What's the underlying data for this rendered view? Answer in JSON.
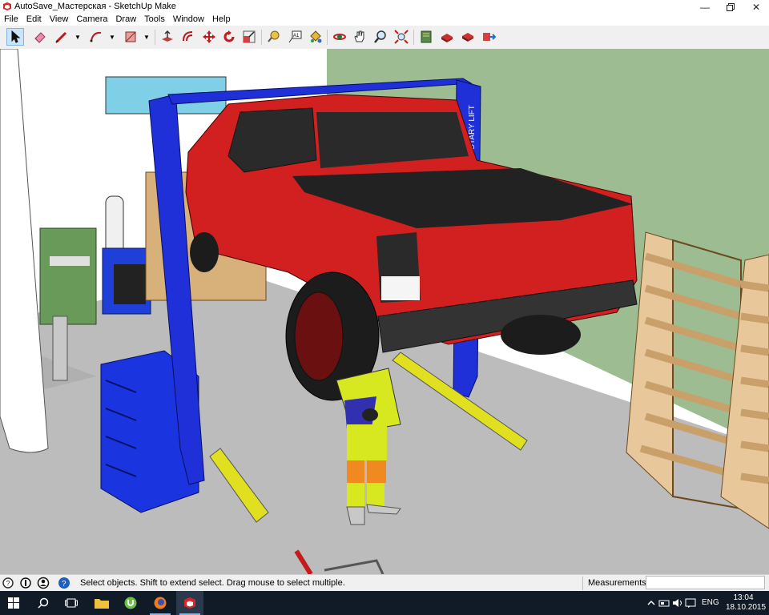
{
  "window": {
    "title": "AutoSave_Мастерская - SketchUp Make",
    "controls": [
      "minimize-icon",
      "restore-icon",
      "close-icon"
    ]
  },
  "menu": [
    "File",
    "Edit",
    "View",
    "Camera",
    "Draw",
    "Tools",
    "Window",
    "Help"
  ],
  "toolbar": {
    "tools": [
      {
        "name": "select-tool-icon",
        "active": true
      },
      {
        "name": "eraser-tool-icon"
      },
      {
        "name": "pencil-line-tool-icon",
        "dropdown": true
      },
      {
        "name": "arc-tool-icon",
        "dropdown": true
      },
      {
        "name": "shapes-tool-icon",
        "dropdown": true
      },
      {
        "name": "push-pull-tool-icon"
      },
      {
        "name": "offset-tool-icon"
      },
      {
        "name": "move-tool-icon"
      },
      {
        "name": "rotate-tool-icon"
      },
      {
        "name": "scale-tool-icon"
      },
      {
        "name": "tape-measure-tool-icon"
      },
      {
        "name": "text-tool-icon"
      },
      {
        "name": "paint-bucket-tool-icon"
      },
      {
        "name": "orbit-tool-icon"
      },
      {
        "name": "pan-tool-icon"
      },
      {
        "name": "zoom-tool-icon"
      },
      {
        "name": "zoom-extents-tool-icon"
      },
      {
        "name": "warehouse-icon"
      },
      {
        "name": "get-models-icon"
      },
      {
        "name": "share-model-icon"
      },
      {
        "name": "extension-warehouse-icon"
      }
    ]
  },
  "scene": {
    "lift_brand_text": "ROTARY LIFT",
    "colors": {
      "wall_white": "#ffffff",
      "wall_green": "#9dbc91",
      "floor": "#bcbcbc",
      "truck_red": "#d21f1f",
      "lift_blue": "#1f2fd0",
      "lift_arm_yellow": "#e0e020",
      "shelf_wood": "#e8c79b"
    }
  },
  "statusbar": {
    "hint": "Select objects. Shift to extend select. Drag mouse to select multiple.",
    "measurements_label": "Measurements",
    "measurements_value": ""
  },
  "taskbar": {
    "apps": [
      "start-icon",
      "search-icon",
      "task-view-icon",
      "file-explorer-icon",
      "utorrent-icon",
      "firefox-icon",
      "sketchup-icon"
    ],
    "language": "ENG",
    "time": "13:04",
    "date": "18.10.2015"
  }
}
